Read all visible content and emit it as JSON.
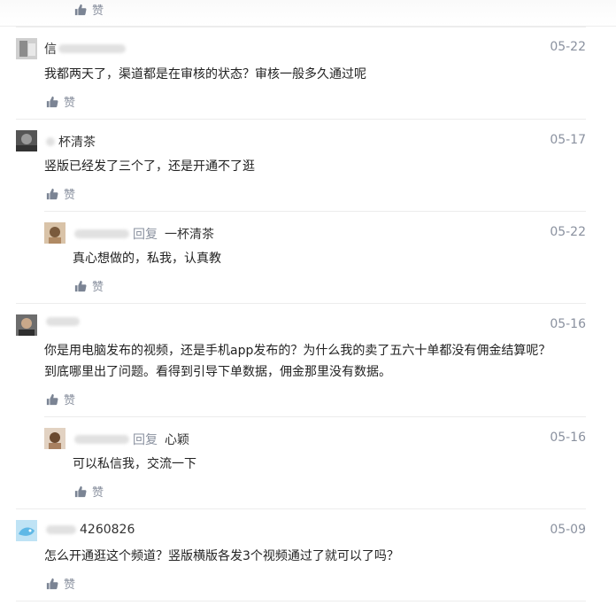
{
  "like_label": "赞",
  "comments": [
    {
      "name": "信",
      "date": "05-22",
      "text": "我都两天了，渠道都是在审核的状态？审核一般多久通过呢",
      "avatar": "avatar-1"
    },
    {
      "name": "杯清茶",
      "date": "05-17",
      "text": "竖版已经发了三个了，还是开通不了逛",
      "avatar": "avatar-2"
    },
    {
      "name": "",
      "reply_word": "回复",
      "reply_to": "一杯清茶",
      "date": "05-22",
      "text": "真心想做的，私我，认真教",
      "avatar": "avatar-3"
    },
    {
      "name": "",
      "date": "05-16",
      "lines": [
        "你是用电脑发布的视频，还是手机app发布的？为什么我的卖了五六十单都没有佣金结算呢？",
        "到底哪里出了问题。看得到引导下单数据，佣金那里没有数据。"
      ],
      "avatar": "avatar-4"
    },
    {
      "name": "",
      "reply_word": "回复",
      "reply_to": "心颖",
      "date": "05-16",
      "text": "可以私信我，交流一下",
      "avatar": "avatar-5"
    },
    {
      "name": "4260826",
      "date": "05-09",
      "text": "怎么开通逛这个频道？竖版横版各发3个视频通过了就可以了吗？",
      "avatar": "avatar-6"
    }
  ]
}
